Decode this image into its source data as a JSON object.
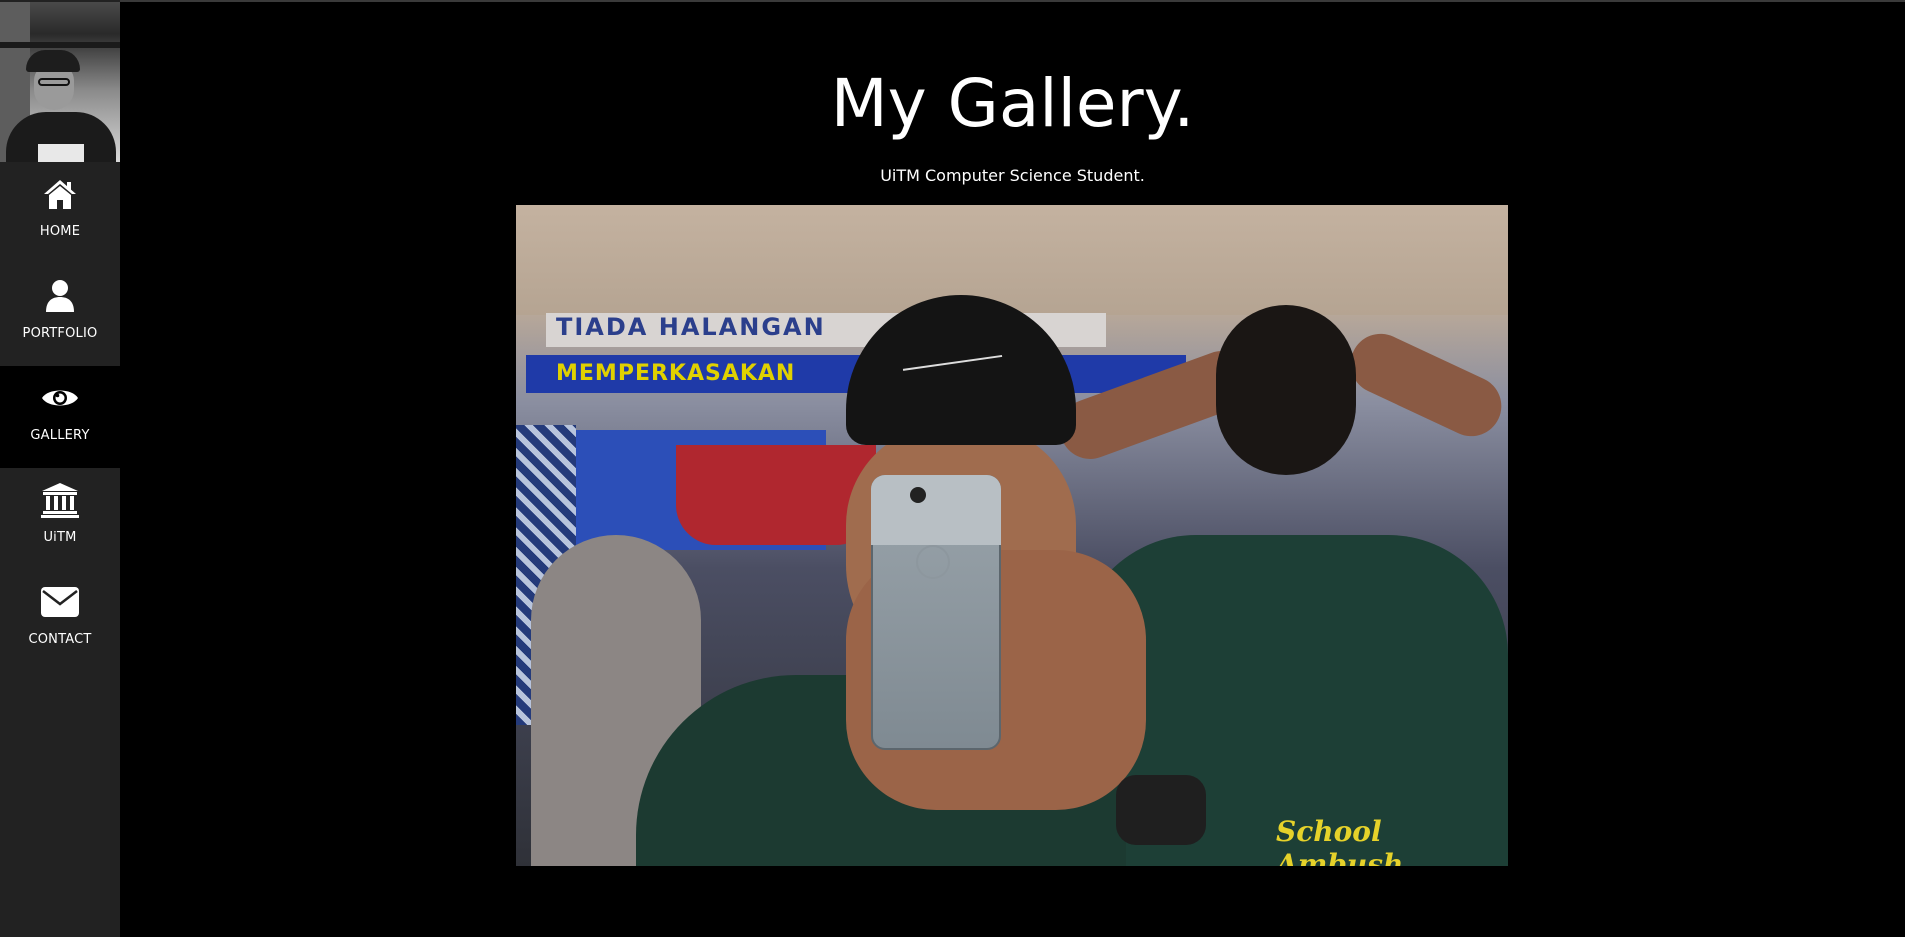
{
  "sidebar": {
    "avatar_alt": "profile photo",
    "items": [
      {
        "label": "HOME",
        "icon": "home-icon",
        "active": false
      },
      {
        "label": "PORTFOLIO",
        "icon": "user-icon",
        "active": false
      },
      {
        "label": "GALLERY",
        "icon": "eye-icon",
        "active": true
      },
      {
        "label": "UiTM",
        "icon": "institution-icon",
        "active": false
      },
      {
        "label": "CONTACT",
        "icon": "envelope-icon",
        "active": false
      }
    ]
  },
  "main": {
    "title": "My Gallery.",
    "subtitle": "UiTM Computer Science Student."
  },
  "photo": {
    "banner_line1": "TIADA HALANGAN",
    "banner_line2": "MEMPERKASAKAN",
    "shirt_text": "School Ambush"
  },
  "colors": {
    "sidebar_bg": "#222222",
    "active_bg": "#000000",
    "page_bg": "#000000",
    "text": "#ffffff"
  }
}
